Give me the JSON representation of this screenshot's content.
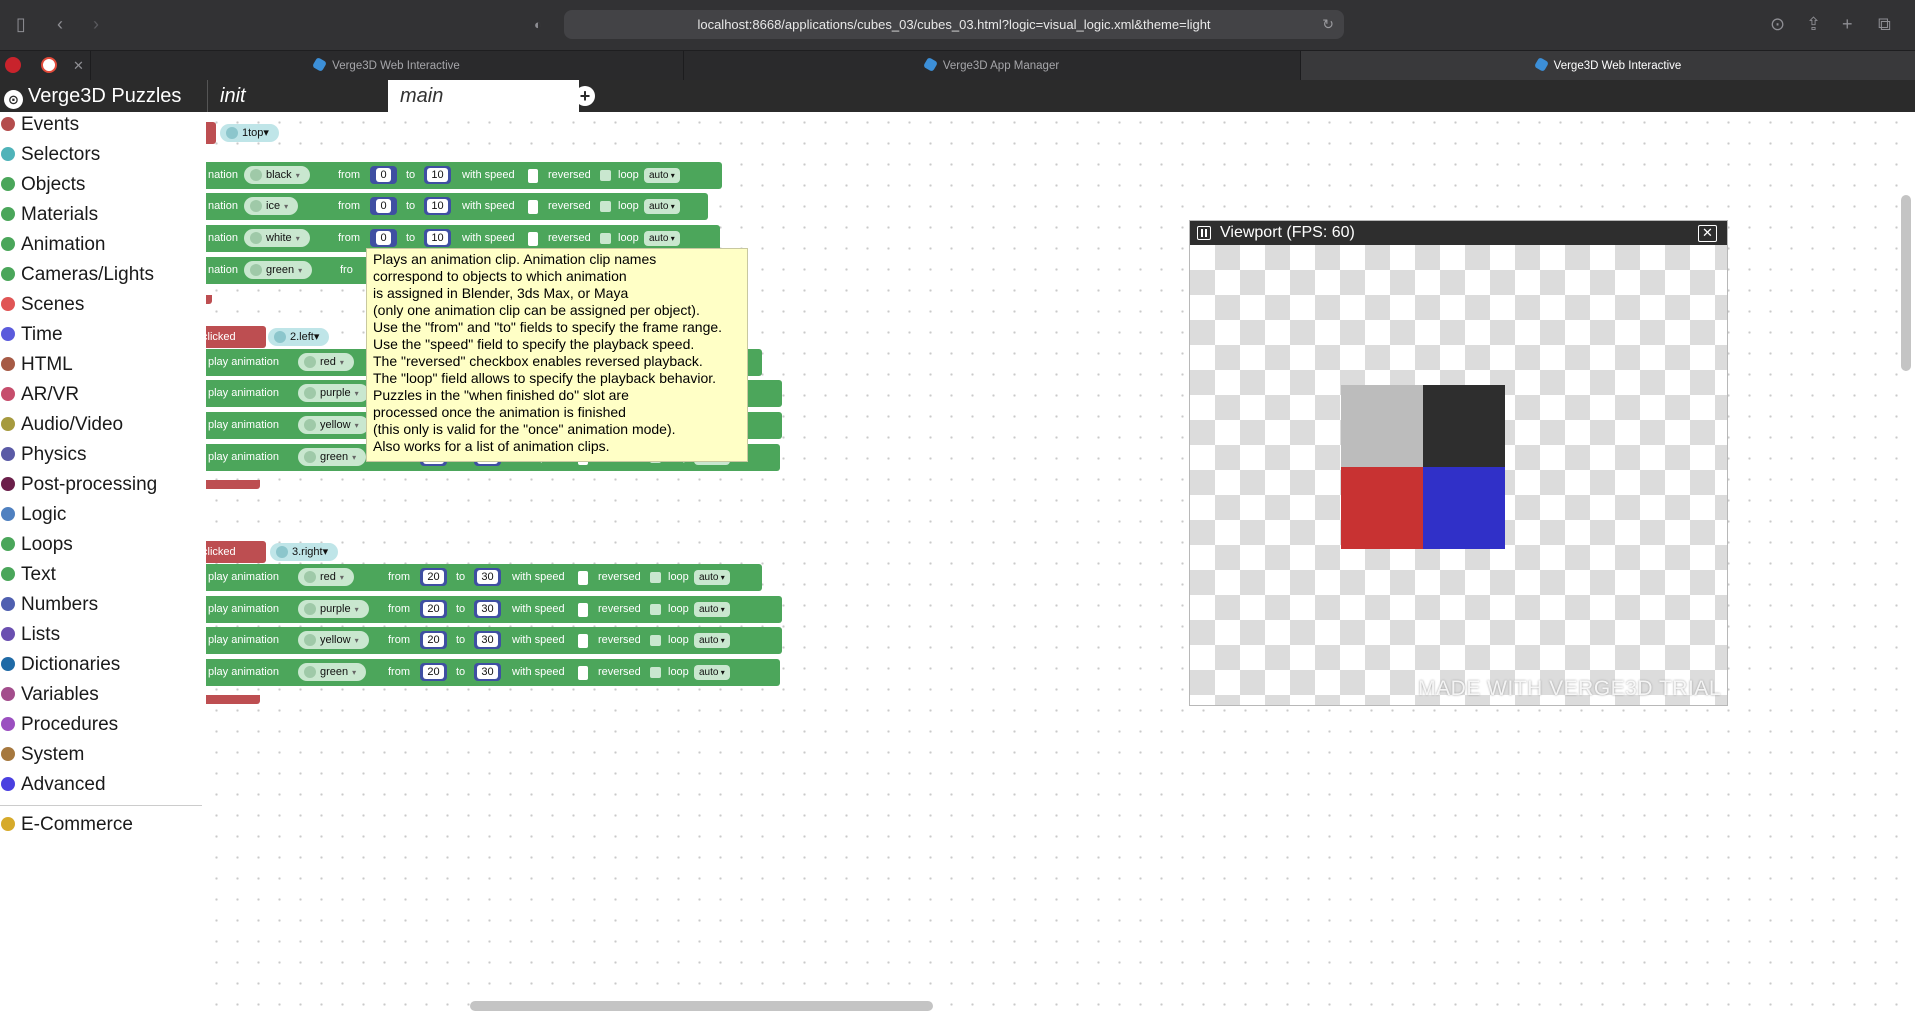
{
  "browser": {
    "url": "localhost:8668/applications/cubes_03/cubes_03.html?logic=visual_logic.xml&theme=light",
    "tabs": [
      {
        "title": "Verge3D Web Interactive"
      },
      {
        "title": "Verge3D App Manager"
      },
      {
        "title": "Verge3D Web Interactive"
      }
    ]
  },
  "editor": {
    "brand": "Verge3D Puzzles",
    "tabs": [
      "init",
      "main"
    ]
  },
  "categories": [
    {
      "label": "Events",
      "color": "#b44d4d"
    },
    {
      "label": "Selectors",
      "color": "#4fb3b9"
    },
    {
      "label": "Objects",
      "color": "#4aa65a"
    },
    {
      "label": "Materials",
      "color": "#4aa65a"
    },
    {
      "label": "Animation",
      "color": "#4aa65a"
    },
    {
      "label": "Cameras/Lights",
      "color": "#4aa65a"
    },
    {
      "label": "Scenes",
      "color": "#e05555"
    },
    {
      "label": "Time",
      "color": "#5b5bdc"
    },
    {
      "label": "HTML",
      "color": "#a65a45"
    },
    {
      "label": "AR/VR",
      "color": "#c64d6c"
    },
    {
      "label": "Audio/Video",
      "color": "#a69a3e"
    },
    {
      "label": "Physics",
      "color": "#5a5aa6"
    },
    {
      "label": "Post-processing",
      "color": "#6b1f4a"
    },
    {
      "label": "Logic",
      "color": "#4f80c0"
    },
    {
      "label": "Loops",
      "color": "#4aa65a"
    },
    {
      "label": "Text",
      "color": "#4aa65a"
    },
    {
      "label": "Numbers",
      "color": "#4f5fb0"
    },
    {
      "label": "Lists",
      "color": "#6a4fb0"
    },
    {
      "label": "Dictionaries",
      "color": "#1f6aa6"
    },
    {
      "label": "Variables",
      "color": "#a34d8c"
    },
    {
      "label": "Procedures",
      "color": "#9b4fc0"
    },
    {
      "label": "System",
      "color": "#a6783e"
    },
    {
      "label": "Advanced",
      "color": "#4a3fe0"
    },
    {
      "label": "E-Commerce",
      "color": "#d6aa2a"
    }
  ],
  "labels": {
    "play_animation": "play animation",
    "nation": "nation",
    "from": "from",
    "to": "to",
    "with_speed": "with speed",
    "reversed": "reversed",
    "loop": "loop",
    "auto": "auto",
    "clicked": "clicked",
    "fro": "fro"
  },
  "groups": [
    {
      "selector": "1top",
      "rows": [
        {
          "clip": "black",
          "from": "0",
          "to": "10"
        },
        {
          "clip": "ice",
          "from": "0",
          "to": "10"
        },
        {
          "clip": "white",
          "from": "0",
          "to": "10"
        },
        {
          "clip": "green"
        }
      ]
    },
    {
      "selector": "2.left",
      "rows": [
        {
          "clip": "red"
        },
        {
          "clip": "purple"
        },
        {
          "clip": "yellow"
        },
        {
          "clip": "green",
          "from": "10",
          "to": "20"
        }
      ]
    },
    {
      "selector": "3.right",
      "rows": [
        {
          "clip": "red",
          "from": "20",
          "to": "30"
        },
        {
          "clip": "purple",
          "from": "20",
          "to": "30"
        },
        {
          "clip": "yellow",
          "from": "20",
          "to": "30"
        },
        {
          "clip": "green",
          "from": "20",
          "to": "30"
        }
      ]
    }
  ],
  "tooltip": [
    "Plays an animation clip. Animation clip names",
    "correspond to objects to which animation",
    "is assigned in Blender, 3ds Max, or Maya",
    "(only one animation clip can be assigned per object).",
    "Use the \"from\" and \"to\" fields to specify the frame range.",
    "Use the \"speed\" field to specify the playback speed.",
    "The \"reversed\" checkbox enables reversed playback.",
    "The \"loop\" field allows to specify the playback behavior.",
    "Puzzles in the \"when finished do\" slot are",
    "processed once the animation is finished",
    "(this only is valid for the \"once\" animation mode).",
    "Also works for a list of animation clips."
  ],
  "viewport": {
    "title": "Viewport (FPS: 60)",
    "watermark": "MADE WITH VERGE3D TRIAL",
    "cube_colors": [
      "#bcbcbc",
      "#2e2e2e",
      "#c83232",
      "#3030c8"
    ]
  }
}
